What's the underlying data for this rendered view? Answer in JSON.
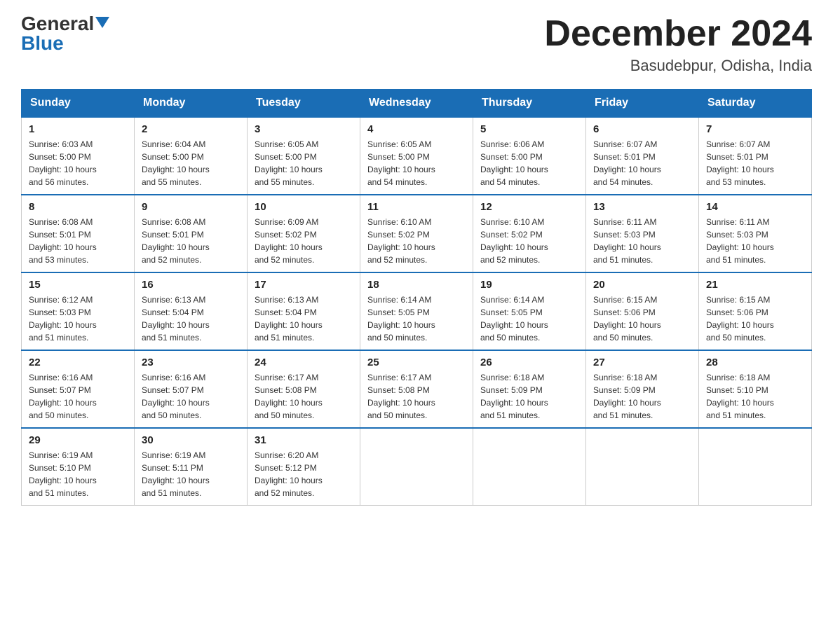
{
  "header": {
    "logo_general": "General",
    "logo_blue": "Blue",
    "month_title": "December 2024",
    "location": "Basudebpur, Odisha, India"
  },
  "days_of_week": [
    "Sunday",
    "Monday",
    "Tuesday",
    "Wednesday",
    "Thursday",
    "Friday",
    "Saturday"
  ],
  "weeks": [
    [
      {
        "day": "1",
        "sunrise": "6:03 AM",
        "sunset": "5:00 PM",
        "daylight": "10 hours and 56 minutes."
      },
      {
        "day": "2",
        "sunrise": "6:04 AM",
        "sunset": "5:00 PM",
        "daylight": "10 hours and 55 minutes."
      },
      {
        "day": "3",
        "sunrise": "6:05 AM",
        "sunset": "5:00 PM",
        "daylight": "10 hours and 55 minutes."
      },
      {
        "day": "4",
        "sunrise": "6:05 AM",
        "sunset": "5:00 PM",
        "daylight": "10 hours and 54 minutes."
      },
      {
        "day": "5",
        "sunrise": "6:06 AM",
        "sunset": "5:00 PM",
        "daylight": "10 hours and 54 minutes."
      },
      {
        "day": "6",
        "sunrise": "6:07 AM",
        "sunset": "5:01 PM",
        "daylight": "10 hours and 54 minutes."
      },
      {
        "day": "7",
        "sunrise": "6:07 AM",
        "sunset": "5:01 PM",
        "daylight": "10 hours and 53 minutes."
      }
    ],
    [
      {
        "day": "8",
        "sunrise": "6:08 AM",
        "sunset": "5:01 PM",
        "daylight": "10 hours and 53 minutes."
      },
      {
        "day": "9",
        "sunrise": "6:08 AM",
        "sunset": "5:01 PM",
        "daylight": "10 hours and 52 minutes."
      },
      {
        "day": "10",
        "sunrise": "6:09 AM",
        "sunset": "5:02 PM",
        "daylight": "10 hours and 52 minutes."
      },
      {
        "day": "11",
        "sunrise": "6:10 AM",
        "sunset": "5:02 PM",
        "daylight": "10 hours and 52 minutes."
      },
      {
        "day": "12",
        "sunrise": "6:10 AM",
        "sunset": "5:02 PM",
        "daylight": "10 hours and 52 minutes."
      },
      {
        "day": "13",
        "sunrise": "6:11 AM",
        "sunset": "5:03 PM",
        "daylight": "10 hours and 51 minutes."
      },
      {
        "day": "14",
        "sunrise": "6:11 AM",
        "sunset": "5:03 PM",
        "daylight": "10 hours and 51 minutes."
      }
    ],
    [
      {
        "day": "15",
        "sunrise": "6:12 AM",
        "sunset": "5:03 PM",
        "daylight": "10 hours and 51 minutes."
      },
      {
        "day": "16",
        "sunrise": "6:13 AM",
        "sunset": "5:04 PM",
        "daylight": "10 hours and 51 minutes."
      },
      {
        "day": "17",
        "sunrise": "6:13 AM",
        "sunset": "5:04 PM",
        "daylight": "10 hours and 51 minutes."
      },
      {
        "day": "18",
        "sunrise": "6:14 AM",
        "sunset": "5:05 PM",
        "daylight": "10 hours and 50 minutes."
      },
      {
        "day": "19",
        "sunrise": "6:14 AM",
        "sunset": "5:05 PM",
        "daylight": "10 hours and 50 minutes."
      },
      {
        "day": "20",
        "sunrise": "6:15 AM",
        "sunset": "5:06 PM",
        "daylight": "10 hours and 50 minutes."
      },
      {
        "day": "21",
        "sunrise": "6:15 AM",
        "sunset": "5:06 PM",
        "daylight": "10 hours and 50 minutes."
      }
    ],
    [
      {
        "day": "22",
        "sunrise": "6:16 AM",
        "sunset": "5:07 PM",
        "daylight": "10 hours and 50 minutes."
      },
      {
        "day": "23",
        "sunrise": "6:16 AM",
        "sunset": "5:07 PM",
        "daylight": "10 hours and 50 minutes."
      },
      {
        "day": "24",
        "sunrise": "6:17 AM",
        "sunset": "5:08 PM",
        "daylight": "10 hours and 50 minutes."
      },
      {
        "day": "25",
        "sunrise": "6:17 AM",
        "sunset": "5:08 PM",
        "daylight": "10 hours and 50 minutes."
      },
      {
        "day": "26",
        "sunrise": "6:18 AM",
        "sunset": "5:09 PM",
        "daylight": "10 hours and 51 minutes."
      },
      {
        "day": "27",
        "sunrise": "6:18 AM",
        "sunset": "5:09 PM",
        "daylight": "10 hours and 51 minutes."
      },
      {
        "day": "28",
        "sunrise": "6:18 AM",
        "sunset": "5:10 PM",
        "daylight": "10 hours and 51 minutes."
      }
    ],
    [
      {
        "day": "29",
        "sunrise": "6:19 AM",
        "sunset": "5:10 PM",
        "daylight": "10 hours and 51 minutes."
      },
      {
        "day": "30",
        "sunrise": "6:19 AM",
        "sunset": "5:11 PM",
        "daylight": "10 hours and 51 minutes."
      },
      {
        "day": "31",
        "sunrise": "6:20 AM",
        "sunset": "5:12 PM",
        "daylight": "10 hours and 52 minutes."
      },
      null,
      null,
      null,
      null
    ]
  ],
  "labels": {
    "sunrise": "Sunrise:",
    "sunset": "Sunset:",
    "daylight": "Daylight:"
  }
}
